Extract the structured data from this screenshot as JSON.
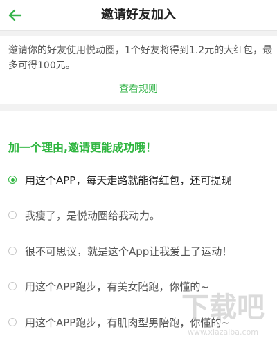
{
  "header": {
    "title": "邀请好友加入",
    "back_icon": "arrow-left-icon",
    "accent": "#35b44a"
  },
  "invite": {
    "description": "邀请你的好友使用悦动圈，1个好友将得到1.2元的大红包，最多可得100元。",
    "rules_link": "查看规则"
  },
  "reasons": {
    "heading": "加一个理由,邀请更能成功哦！",
    "heading_color": "#2fb640",
    "options": [
      {
        "label": "用这个APP，每天走路就能得红包，还可提现",
        "selected": true
      },
      {
        "label": "我瘦了，是悦动圈给我动力。",
        "selected": false
      },
      {
        "label": "很不可思议，就是这个App让我爱上了运动！",
        "selected": false
      },
      {
        "label": "用这个APP跑步，有美女陪跑，你懂的~",
        "selected": false
      },
      {
        "label": "用这个APP跑步，有肌肉型男陪跑，你懂的~",
        "selected": false
      }
    ]
  },
  "watermark": {
    "text": "下载吧",
    "url": "www.xiazaiba.com"
  }
}
